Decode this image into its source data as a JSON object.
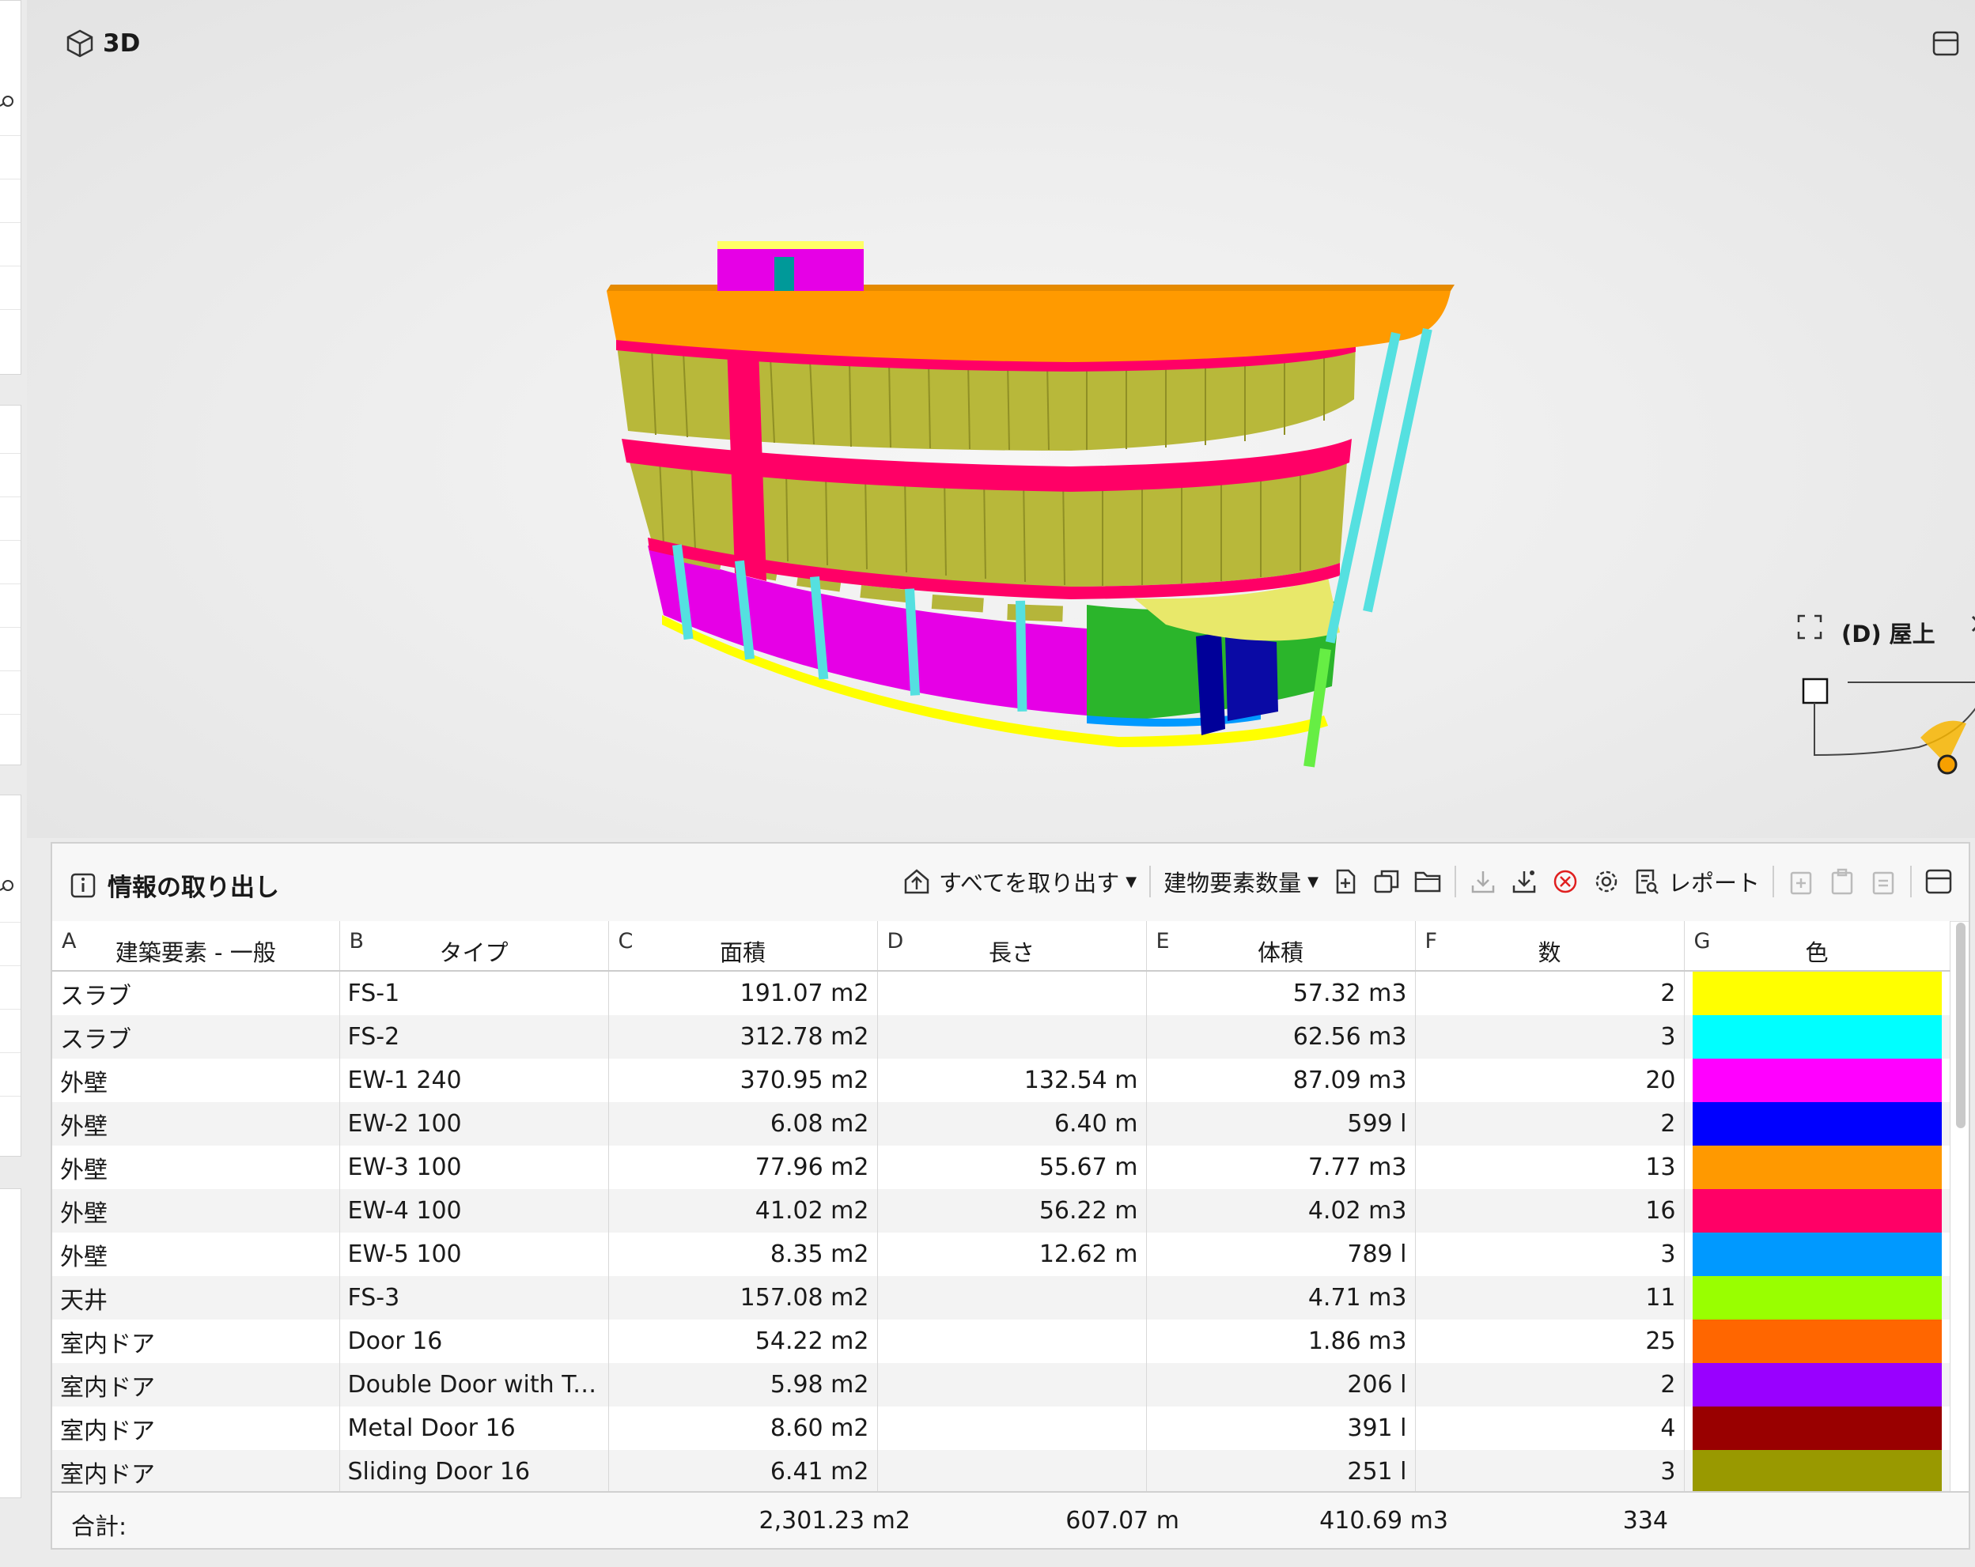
{
  "viewport": {
    "title": "3D",
    "plan": {
      "title": "(D) 屋上"
    }
  },
  "panel": {
    "title": "情報の取り出し",
    "toolbar": {
      "extract_all": "すべてを取り出す",
      "preset": "建物要素数量",
      "report": "レポート"
    },
    "columns": [
      {
        "letter": "A",
        "label": "建築要素 - 一般"
      },
      {
        "letter": "B",
        "label": "タイプ"
      },
      {
        "letter": "C",
        "label": "面積"
      },
      {
        "letter": "D",
        "label": "長さ"
      },
      {
        "letter": "E",
        "label": "体積"
      },
      {
        "letter": "F",
        "label": "数"
      },
      {
        "letter": "G",
        "label": "色"
      }
    ],
    "rows": [
      {
        "category": "スラブ",
        "type": "FS-1",
        "area": "191.07 m2",
        "length": "",
        "volume": "57.32 m3",
        "count": "2",
        "color": "#ffff00"
      },
      {
        "category": "スラブ",
        "type": "FS-2",
        "area": "312.78 m2",
        "length": "",
        "volume": "62.56 m3",
        "count": "3",
        "color": "#00ffff"
      },
      {
        "category": "外壁",
        "type": "EW-1 240",
        "area": "370.95 m2",
        "length": "132.54 m",
        "volume": "87.09 m3",
        "count": "20",
        "color": "#ff00ff"
      },
      {
        "category": "外壁",
        "type": "EW-2 100",
        "area": "6.08 m2",
        "length": "6.40 m",
        "volume": "599 l",
        "count": "2",
        "color": "#0000ff"
      },
      {
        "category": "外壁",
        "type": "EW-3 100",
        "area": "77.96 m2",
        "length": "55.67 m",
        "volume": "7.77 m3",
        "count": "13",
        "color": "#ff9900"
      },
      {
        "category": "外壁",
        "type": "EW-4 100",
        "area": "41.02 m2",
        "length": "56.22 m",
        "volume": "4.02 m3",
        "count": "16",
        "color": "#ff0066"
      },
      {
        "category": "外壁",
        "type": "EW-5 100",
        "area": "8.35 m2",
        "length": "12.62 m",
        "volume": "789 l",
        "count": "3",
        "color": "#0099ff"
      },
      {
        "category": "天井",
        "type": "FS-3",
        "area": "157.08 m2",
        "length": "",
        "volume": "4.71 m3",
        "count": "11",
        "color": "#99ff00"
      },
      {
        "category": "室内ドア",
        "type": "Door 16",
        "area": "54.22 m2",
        "length": "",
        "volume": "1.86 m3",
        "count": "25",
        "color": "#ff6600"
      },
      {
        "category": "室内ドア",
        "type": "Double Door with Tr...",
        "area": "5.98 m2",
        "length": "",
        "volume": "206 l",
        "count": "2",
        "color": "#9900ff"
      },
      {
        "category": "室内ドア",
        "type": "Metal Door 16",
        "area": "8.60 m2",
        "length": "",
        "volume": "391 l",
        "count": "4",
        "color": "#990000"
      },
      {
        "category": "室内ドア",
        "type": "Sliding Door 16",
        "area": "6.41 m2",
        "length": "",
        "volume": "251 l",
        "count": "3",
        "color": "#999900"
      }
    ],
    "totals": {
      "label": "合計:",
      "area": "2,301.23 m2",
      "length": "607.07 m",
      "volume": "410.69 m3",
      "count": "334"
    }
  }
}
